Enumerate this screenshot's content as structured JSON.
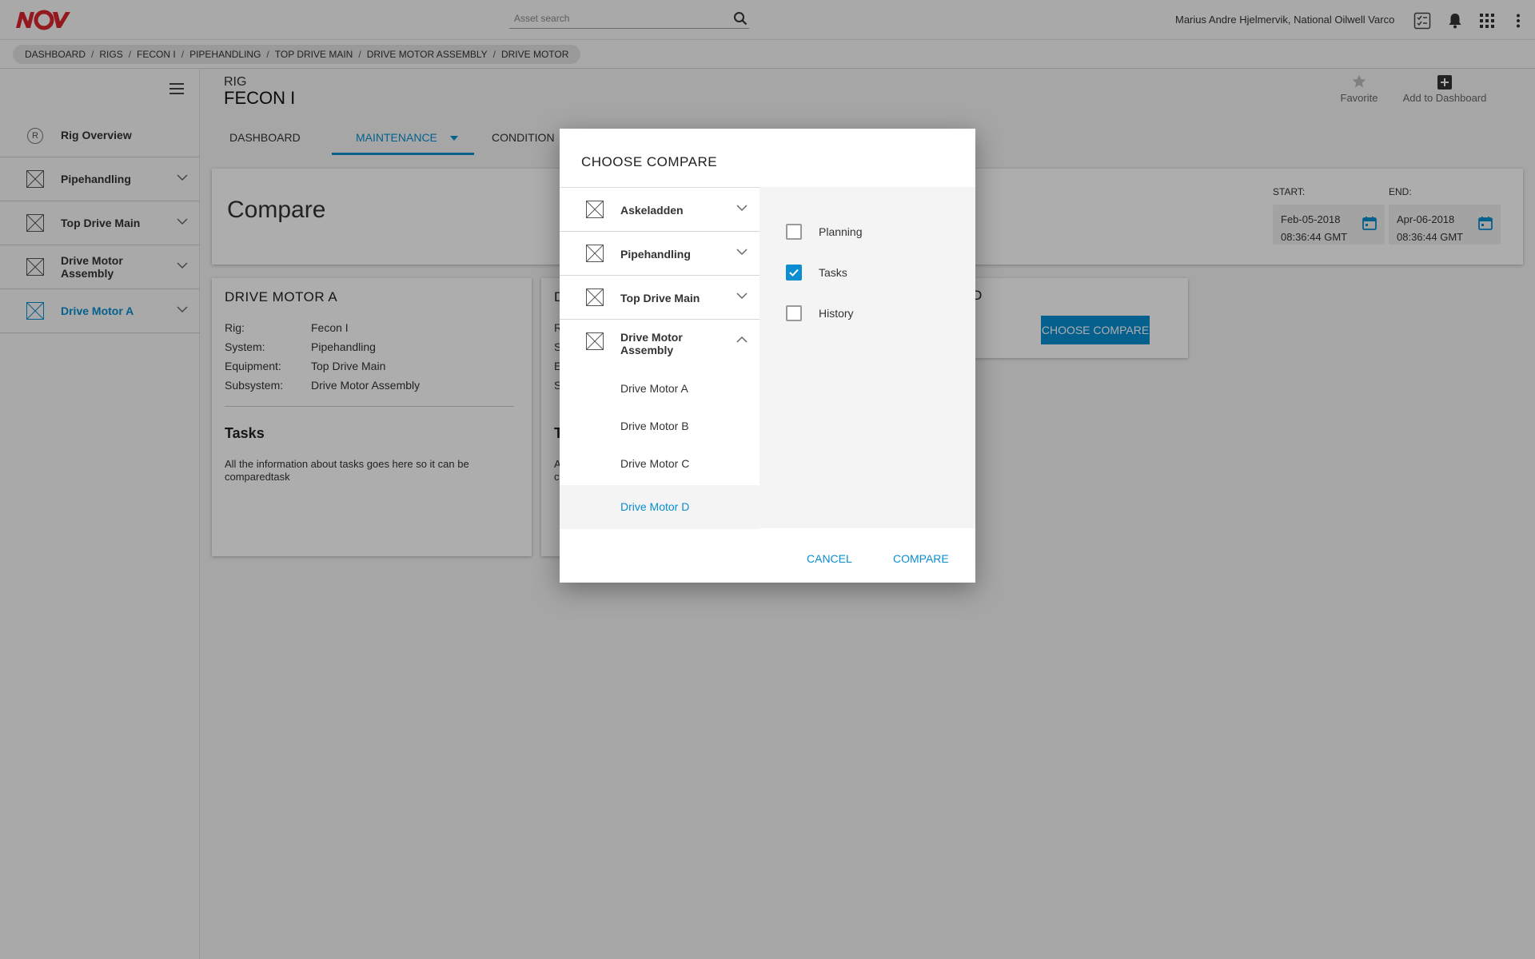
{
  "header": {
    "logo_text": "NOV",
    "search_placeholder": "Asset search",
    "user_name": "Marius Andre Hjelmervik, National Oilwell Varco"
  },
  "breadcrumb": [
    "DASHBOARD",
    "RIGS",
    "FECON I",
    "PIPEHANDLING",
    "TOP DRIVE MAIN",
    "DRIVE MOTOR ASSEMBLY",
    "DRIVE MOTOR"
  ],
  "sidebar": {
    "items": [
      {
        "label": "Rig Overview",
        "icon": "r-circle-icon"
      },
      {
        "label": "Pipehandling",
        "icon": "placeholder-x-icon"
      },
      {
        "label": "Top Drive Main",
        "icon": "placeholder-x-icon"
      },
      {
        "label": "Drive Motor Assembly",
        "icon": "placeholder-x-icon"
      },
      {
        "label": "Drive Motor A",
        "icon": "placeholder-x-icon",
        "active": true
      }
    ]
  },
  "rig": {
    "type_label": "RIG",
    "name": "FECON I"
  },
  "actions": {
    "favorite": "Favorite",
    "add_dashboard": "Add to Dashboard"
  },
  "tabs": [
    {
      "label": "DASHBOARD"
    },
    {
      "label": "MAINTENANCE",
      "active": true
    },
    {
      "label": "CONDITION"
    }
  ],
  "compare": {
    "title": "Compare",
    "start_label": "START:",
    "start_date": "Feb-05-2018",
    "start_time": "08:36:44 GMT",
    "end_label": "END:",
    "end_date": "Apr-06-2018",
    "end_time": "08:36:44 GMT"
  },
  "motor_card": {
    "title": "DRIVE MOTOR A",
    "rig_key": "Rig:",
    "rig_val": "Fecon I",
    "system_key": "System:",
    "system_val": "Pipehandling",
    "equipment_key": "Equipment:",
    "equipment_val": "Top Drive Main",
    "subsystem_key": "Subsystem:",
    "subsystem_val": "Drive Motor Assembly",
    "tasks_title": "Tasks",
    "tasks_body": "All the information about tasks goes here so it can be comparedtask"
  },
  "second_card_peek": {
    "title_char": "D",
    "tasks_char": "T",
    "row_chars": [
      "R",
      "S",
      "E",
      "S"
    ],
    "body_chars": [
      "A",
      "c"
    ]
  },
  "choose_card": {
    "peek": "D",
    "button": "CHOOSE COMPARE"
  },
  "modal": {
    "title": "CHOOSE COMPARE",
    "left_items": [
      {
        "label": "Askeladden",
        "expanded": false
      },
      {
        "label": "Pipehandling",
        "expanded": false
      },
      {
        "label": "Top Drive Main",
        "expanded": false
      },
      {
        "label": "Drive Motor Assembly",
        "expanded": true
      }
    ],
    "sub_items": [
      "Drive Motor A",
      "Drive Motor B",
      "Drive Motor C",
      "Drive Motor D"
    ],
    "selected_sub": "Drive Motor D",
    "options": [
      {
        "label": "Planning",
        "checked": false
      },
      {
        "label": "Tasks",
        "checked": true
      },
      {
        "label": "History",
        "checked": false
      }
    ],
    "cancel": "CANCEL",
    "compare": "COMPARE"
  },
  "colors": {
    "accent": "#0a8ed1",
    "brand_red": "#d9262e"
  }
}
